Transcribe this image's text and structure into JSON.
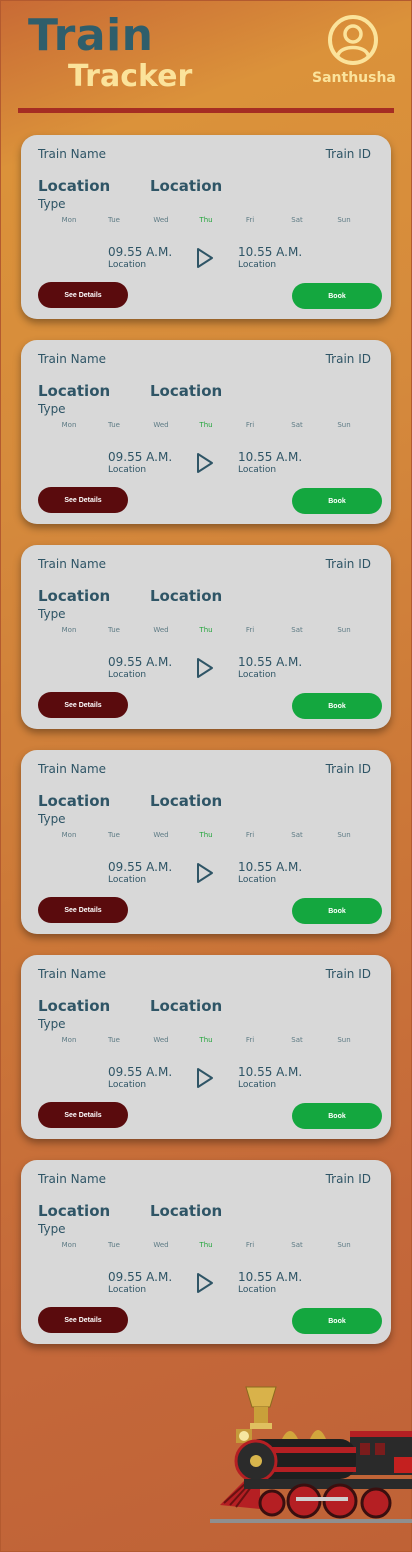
{
  "header": {
    "logo_line1": "Train",
    "logo_line2": "Tracker",
    "user_name": "Santhusha"
  },
  "days": [
    "Mon",
    "Tue",
    "Wed",
    "Thu",
    "Fri",
    "Sat",
    "Sun"
  ],
  "active_day": "Thu",
  "colors": {
    "active_day": "#27a63f",
    "see_details_button": "#5a0b0d",
    "book_button": "#14a73f",
    "divider": "#a52d23"
  },
  "cards": [
    {
      "train_name": "Train Name",
      "train_id": "Train ID",
      "from": "Location",
      "to": "Location",
      "type": "Type",
      "dep_time": "09.55 A.M.",
      "dep_location": "Location",
      "arr_time": "10.55 A.M.",
      "arr_location": "Location",
      "details_label": "See Details",
      "book_label": "Book"
    },
    {
      "train_name": "Train Name",
      "train_id": "Train ID",
      "from": "Location",
      "to": "Location",
      "type": "Type",
      "dep_time": "09.55 A.M.",
      "dep_location": "Location",
      "arr_time": "10.55 A.M.",
      "arr_location": "Location",
      "details_label": "See Details",
      "book_label": "Book"
    },
    {
      "train_name": "Train Name",
      "train_id": "Train ID",
      "from": "Location",
      "to": "Location",
      "type": "Type",
      "dep_time": "09.55 A.M.",
      "dep_location": "Location",
      "arr_time": "10.55 A.M.",
      "arr_location": "Location",
      "details_label": "See Details",
      "book_label": "Book"
    },
    {
      "train_name": "Train Name",
      "train_id": "Train ID",
      "from": "Location",
      "to": "Location",
      "type": "Type",
      "dep_time": "09.55 A.M.",
      "dep_location": "Location",
      "arr_time": "10.55 A.M.",
      "arr_location": "Location",
      "details_label": "See Details",
      "book_label": "Book"
    },
    {
      "train_name": "Train Name",
      "train_id": "Train ID",
      "from": "Location",
      "to": "Location",
      "type": "Type",
      "dep_time": "09.55 A.M.",
      "dep_location": "Location",
      "arr_time": "10.55 A.M.",
      "arr_location": "Location",
      "details_label": "See Details",
      "book_label": "Book"
    },
    {
      "train_name": "Train Name",
      "train_id": "Train ID",
      "from": "Location",
      "to": "Location",
      "type": "Type",
      "dep_time": "09.55 A.M.",
      "dep_location": "Location",
      "arr_time": "10.55 A.M.",
      "arr_location": "Location",
      "details_label": "See Details",
      "book_label": "Book"
    }
  ],
  "icons": {
    "user": "user-circle-icon",
    "play": "play-icon",
    "train": "steam-locomotive-illustration"
  }
}
